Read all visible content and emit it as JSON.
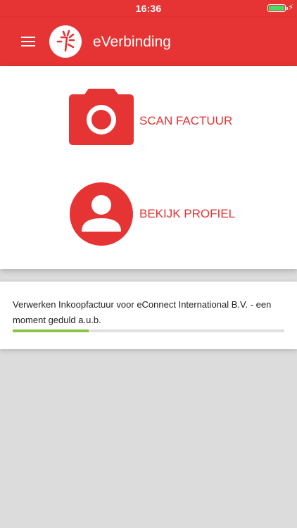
{
  "status_bar": {
    "time": "16:36",
    "battery_level": 1.0,
    "battery_charging": true,
    "charging_glyph": "⚡"
  },
  "app_bar": {
    "title": "eVerbinding",
    "menu_icon": "menu-icon",
    "logo_icon": "everbinding-logo"
  },
  "actions": {
    "scan": {
      "label": "SCAN FACTUUR",
      "icon": "camera-icon"
    },
    "profile": {
      "label": "BEKIJK PROFIEL",
      "icon": "user-profile-icon"
    }
  },
  "progress": {
    "message": "Verwerken Inkoopfactuur voor eConnect International B.V. - een moment geduld a.u.b.",
    "fraction": 0.28
  },
  "colors": {
    "brand": "#e63333",
    "progress": "#8bc34a",
    "battery": "#4cd964",
    "background": "#dcdcdc"
  }
}
